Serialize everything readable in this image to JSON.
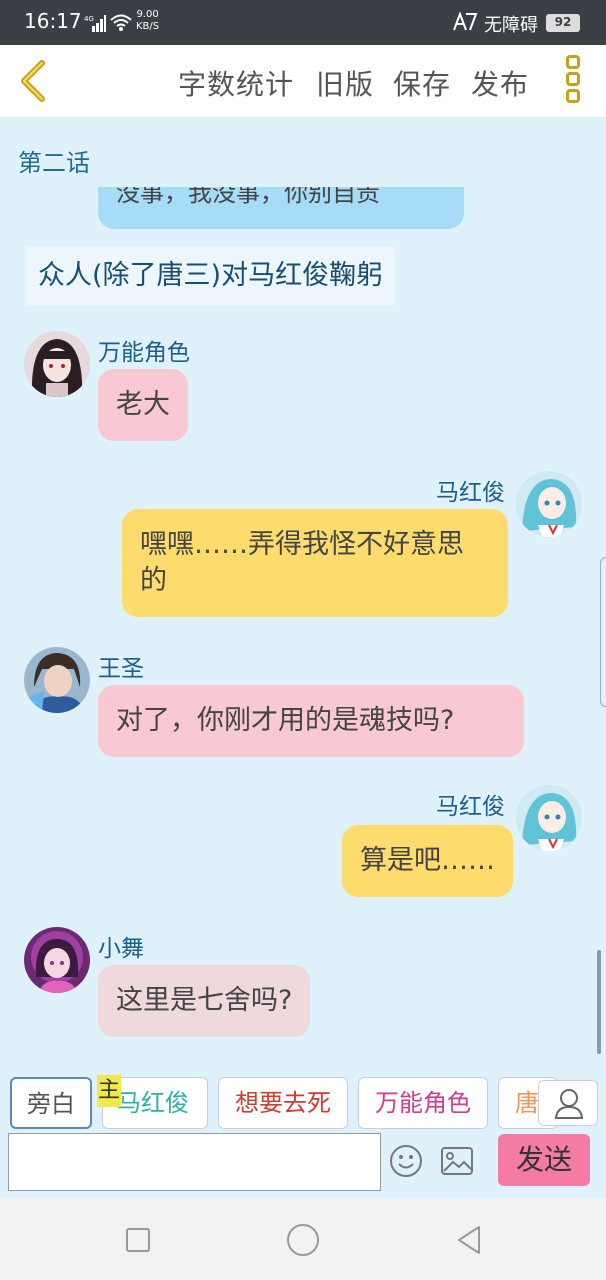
{
  "status_bar": {
    "time": "16:17",
    "network": "4G",
    "speed_value": "9.00",
    "speed_unit": "KB/S",
    "accessibility": "无障碍",
    "battery": "92"
  },
  "toolbar": {
    "word_count": "字数统计",
    "old_version": "旧版",
    "save": "保存",
    "publish": "发布"
  },
  "chat": {
    "chapter_title": "第二话",
    "cut_bubble_text": "没事，我没事，你别自责",
    "narration": "众人(除了唐三)对马红俊鞠躬",
    "messages": [
      {
        "speaker": "万能角色",
        "text": "老大",
        "side": "left",
        "color": "#f8c8d3"
      },
      {
        "speaker": "马红俊",
        "text": "嘿嘿……弄得我怪不好意思的",
        "side": "right",
        "color": "#fddb6d"
      },
      {
        "speaker": "王圣",
        "text": "对了，你刚才用的是魂技吗?",
        "side": "left",
        "color": "#f8c8d3"
      },
      {
        "speaker": "马红俊",
        "text": "算是吧……",
        "side": "right",
        "color": "#fddb6d"
      },
      {
        "speaker": "小舞",
        "text": "这里是七舍吗?",
        "side": "left",
        "color": "#efd9dc"
      }
    ]
  },
  "character_bar": {
    "main_mark": "主",
    "chips": [
      {
        "label": "旁白",
        "color": "#555555"
      },
      {
        "label": "马红俊",
        "color": "#27b3a8"
      },
      {
        "label": "想要去死",
        "color": "#d23b2f"
      },
      {
        "label": "万能角色",
        "color": "#d63a8f"
      },
      {
        "label": "唐",
        "color": "#f0955a"
      }
    ]
  },
  "input": {
    "value": "",
    "placeholder": "",
    "send_label": "发送"
  }
}
